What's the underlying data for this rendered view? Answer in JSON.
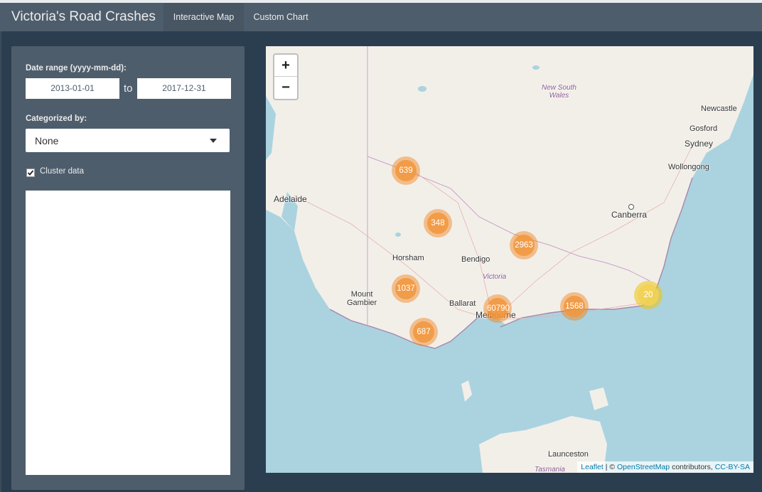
{
  "navbar": {
    "title": "Victoria's Road Crashes",
    "tabs": [
      {
        "label": "Interactive Map",
        "active": true
      },
      {
        "label": "Custom Chart",
        "active": false
      }
    ]
  },
  "sidebar": {
    "date_range_label": "Date range (yyyy-mm-dd):",
    "date_start": "2013-01-01",
    "date_end": "2017-12-31",
    "date_separator": "to",
    "categorized_label": "Categorized by:",
    "categorized_value": "None",
    "cluster_label": "Cluster data",
    "cluster_checked": true
  },
  "map": {
    "zoom_in": "+",
    "zoom_out": "−",
    "places": {
      "adelaide": "Adelaide",
      "canberra": "Canberra",
      "sydney": "Sydney",
      "newcastle": "Newcastle",
      "gosford": "Gosford",
      "wollongong": "Wollongong",
      "horsham": "Horsham",
      "bendigo": "Bendigo",
      "ballarat": "Ballarat",
      "mount_gambier_1": "Mount",
      "mount_gambier_2": "Gambier",
      "melbourne": "Melbourne",
      "launceston": "Launceston",
      "tasmania": "Tasmania",
      "nsw_1": "New South",
      "nsw_2": "Wales",
      "victoria": "Victoria"
    },
    "clusters": [
      {
        "count": "639",
        "level": "medium"
      },
      {
        "count": "348",
        "level": "medium"
      },
      {
        "count": "2963",
        "level": "medium"
      },
      {
        "count": "1037",
        "level": "medium"
      },
      {
        "count": "60790",
        "level": "medium"
      },
      {
        "count": "1568",
        "level": "medium"
      },
      {
        "count": "687",
        "level": "medium"
      },
      {
        "count": "20",
        "level": "small"
      }
    ],
    "attribution": {
      "leaflet": "Leaflet",
      "sep": " | © ",
      "osm": "OpenStreetMap",
      "contrib": " contributors, ",
      "license": "CC-BY-SA"
    }
  },
  "colors": {
    "navbar": "#4e5d6c",
    "background": "#2b3e50",
    "water": "#aad3df",
    "land": "#f2efe9",
    "cluster_medium": "#f1963c",
    "cluster_small": "#f1d357"
  }
}
